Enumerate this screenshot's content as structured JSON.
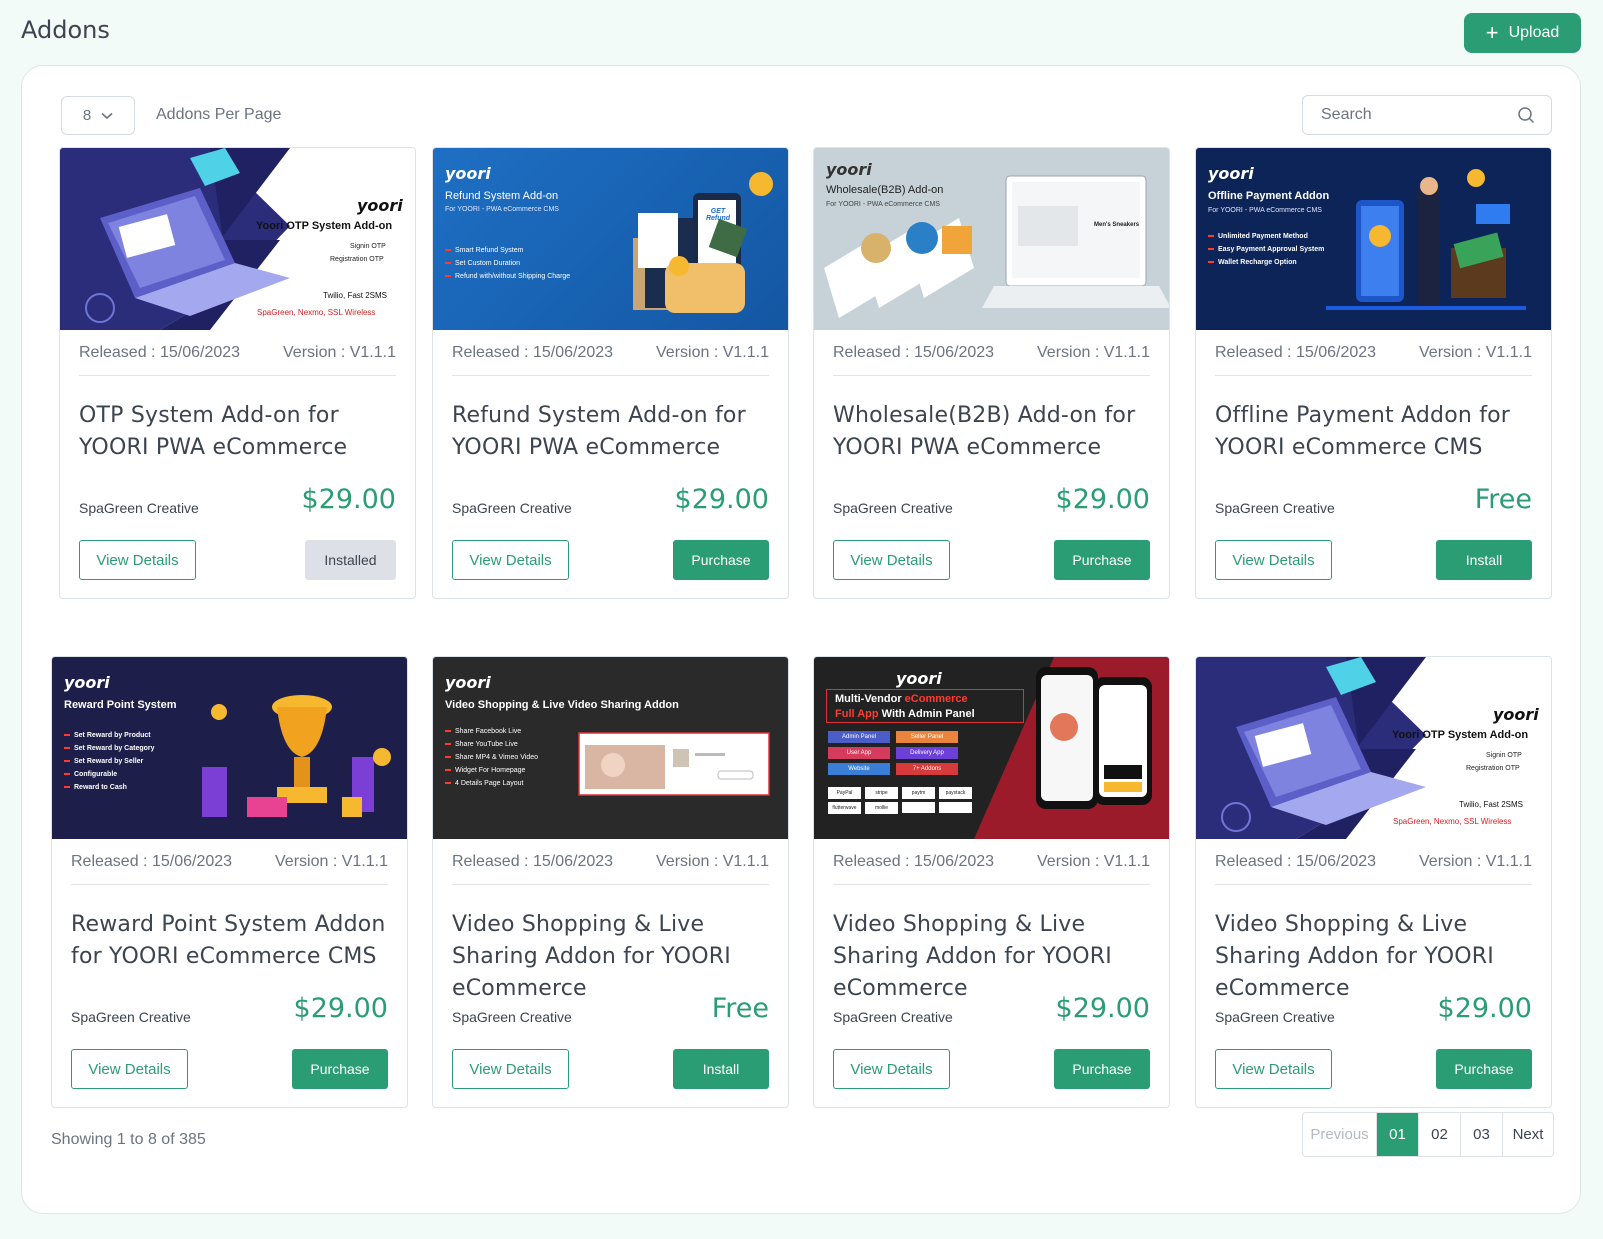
{
  "header": {
    "title": "Addons",
    "upload_label": "Upload"
  },
  "toolbar": {
    "per_page_value": "8",
    "per_page_label": "Addons Per Page",
    "search_placeholder": "Search"
  },
  "colors": {
    "accent": "#2a9d74",
    "installed_bg": "#dde1e7"
  },
  "cards": [
    {
      "released_label": "Released :",
      "released": "15/06/2023",
      "version_label": "Version :",
      "version": "V1.1.1",
      "title": "OTP System Add-on for YOORI PWA eCommerce",
      "author": "SpaGreen Creative",
      "price": "$29.00",
      "details_label": "View Details",
      "action_label": "Installed",
      "action_state": "installed",
      "banner": {
        "logo": "yoori",
        "heading": "Yoori OTP System Add-on",
        "line1": "Signin OTP",
        "line2": "Registration OTP",
        "line3": "Twilio, Fast 2SMS",
        "line4": "SpaGreen, Nexmo, SSL Wireless"
      }
    },
    {
      "released_label": "Released :",
      "released": "15/06/2023",
      "version_label": "Version :",
      "version": "V1.1.1",
      "title": "Refund System Add-on for YOORI PWA eCommerce",
      "author": "SpaGreen Creative",
      "price": "$29.00",
      "details_label": "View Details",
      "action_label": "Purchase",
      "action_state": "purchase",
      "banner": {
        "logo": "yoori",
        "heading": "Refund System Add-on",
        "sub": "For YOORI - PWA eCommerce CMS",
        "items": [
          "Smart Refund System",
          "Set Custom Duration",
          "Refund with/without Shipping Charge"
        ],
        "badge": "GET Refund"
      }
    },
    {
      "released_label": "Released :",
      "released": "15/06/2023",
      "version_label": "Version :",
      "version": "V1.1.1",
      "title": "Wholesale(B2B) Add-on for YOORI PWA eCommerce",
      "author": "SpaGreen Creative",
      "price": "$29.00",
      "details_label": "View Details",
      "action_label": "Purchase",
      "action_state": "purchase",
      "banner": {
        "logo": "yoori",
        "heading": "Wholesale(B2B) Add-on",
        "sub": "For YOORI - PWA eCommerce CMS",
        "screen_text": "Men's Sneakers"
      }
    },
    {
      "released_label": "Released :",
      "released": "15/06/2023",
      "version_label": "Version :",
      "version": "V1.1.1",
      "title": "Offline Payment Addon for YOORI eCommerce CMS",
      "author": "SpaGreen Creative",
      "price": "Free",
      "details_label": "View Details",
      "action_label": "Install",
      "action_state": "install",
      "banner": {
        "logo": "yoori",
        "heading": "Offline Payment Addon",
        "sub": "For YOORI - PWA eCommerce CMS",
        "items": [
          "Unlimited Payment Method",
          "Easy Payment Approval System",
          "Wallet Recharge Option"
        ]
      }
    },
    {
      "released_label": "Released :",
      "released": "15/06/2023",
      "version_label": "Version :",
      "version": "V1.1.1",
      "title": "Reward Point System Addon for YOORI eCommerce CMS",
      "author": "SpaGreen Creative",
      "price": "$29.00",
      "details_label": "View Details",
      "action_label": "Purchase",
      "action_state": "purchase",
      "banner": {
        "logo": "yoori",
        "heading": "Reward Point System",
        "items": [
          "Set Reward by Product",
          "Set Reward by Category",
          "Set Reward by Seller",
          "Configurable",
          "Reward to Cash"
        ]
      }
    },
    {
      "released_label": "Released :",
      "released": "15/06/2023",
      "version_label": "Version :",
      "version": "V1.1.1",
      "title": "Video Shopping & Live Sharing Addon for YOORI eCommerce",
      "author": "SpaGreen Creative",
      "price": "Free",
      "details_label": "View Details",
      "action_label": "Install",
      "action_state": "install",
      "banner": {
        "logo": "yoori",
        "heading": "Video Shopping & Live Video Sharing Addon",
        "items": [
          "Share Facebook Live",
          "Share YouTube Live",
          "Share MP4 & Vimeo Video",
          "Widget For Homepage",
          "4 Details Page Layout"
        ]
      }
    },
    {
      "released_label": "Released :",
      "released": "15/06/2023",
      "version_label": "Version :",
      "version": "V1.1.1",
      "title": "Video Shopping & Live Sharing Addon for YOORI eCommerce",
      "author": "SpaGreen Creative",
      "price": "$29.00",
      "details_label": "View Details",
      "action_label": "Purchase",
      "action_state": "purchase",
      "banner": {
        "logo": "yoori",
        "heading1": "Multi-Vendor",
        "heading1b": "eCommerce",
        "heading2": "Full App",
        "heading2b": "With Admin Panel",
        "tags": [
          "Admin Panel",
          "Seller Panel",
          "User App",
          "Delivery App",
          "Website",
          "7+ Addons"
        ],
        "payments": [
          "PayPal",
          "stripe",
          "paytm",
          "paystack",
          "flutterwave",
          "mollie",
          "",
          ""
        ]
      }
    },
    {
      "released_label": "Released :",
      "released": "15/06/2023",
      "version_label": "Version :",
      "version": "V1.1.1",
      "title": "Video Shopping & Live Sharing Addon for YOORI eCommerce",
      "author": "SpaGreen Creative",
      "price": "$29.00",
      "details_label": "View Details",
      "action_label": "Purchase",
      "action_state": "purchase",
      "banner": {
        "logo": "yoori",
        "heading": "Yoori OTP System Add-on",
        "line1": "Signin OTP",
        "line2": "Registration OTP",
        "line3": "Twilio, Fast 2SMS",
        "line4": "SpaGreen, Nexmo, SSL Wireless"
      }
    }
  ],
  "footer": {
    "showing": "Showing 1 to 8 of 385",
    "prev": "Previous",
    "pages": [
      "01",
      "02",
      "03"
    ],
    "active_page": "01",
    "next": "Next"
  }
}
